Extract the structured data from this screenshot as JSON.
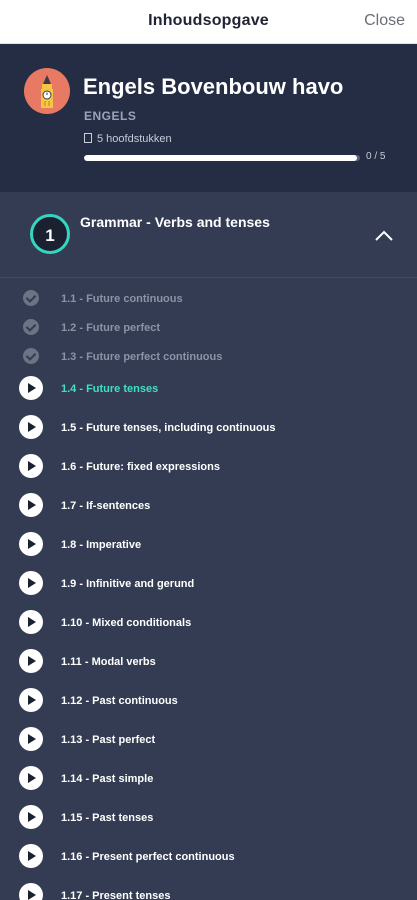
{
  "header": {
    "title": "Inhoudsopgave",
    "close_label": "Close"
  },
  "course": {
    "title": "Engels Bovenbouw havo",
    "subject": "ENGELS",
    "chapters_text": "5 hoofdstukken",
    "progress_label": "0 / 5",
    "progress_fraction": 0.99,
    "avatar_icon": "big-ben-icon"
  },
  "chapter": {
    "number": "1",
    "title": "Grammar - Verbs and tenses",
    "toggle_icon": "chevron-up-icon",
    "accent": "#35d6c0"
  },
  "lessons": [
    {
      "label": "1.1 - Future continuous",
      "state": "done"
    },
    {
      "label": "1.2 - Future perfect",
      "state": "done"
    },
    {
      "label": "1.3 - Future perfect continuous",
      "state": "done"
    },
    {
      "label": "1.4 - Future tenses",
      "state": "active"
    },
    {
      "label": "1.5 - Future tenses, including continuous",
      "state": "todo"
    },
    {
      "label": "1.6 - Future: fixed expressions",
      "state": "todo"
    },
    {
      "label": "1.7 - If-sentences",
      "state": "todo"
    },
    {
      "label": "1.8 - Imperative",
      "state": "todo"
    },
    {
      "label": "1.9 - Infinitive and gerund",
      "state": "todo"
    },
    {
      "label": "1.10 - Mixed conditionals",
      "state": "todo"
    },
    {
      "label": "1.11 - Modal verbs",
      "state": "todo"
    },
    {
      "label": "1.12 - Past continuous",
      "state": "todo"
    },
    {
      "label": "1.13 - Past perfect",
      "state": "todo"
    },
    {
      "label": "1.14 - Past simple",
      "state": "todo"
    },
    {
      "label": "1.15 - Past tenses",
      "state": "todo"
    },
    {
      "label": "1.16 - Present perfect continuous",
      "state": "todo"
    },
    {
      "label": "1.17 - Present tenses",
      "state": "todo"
    }
  ]
}
